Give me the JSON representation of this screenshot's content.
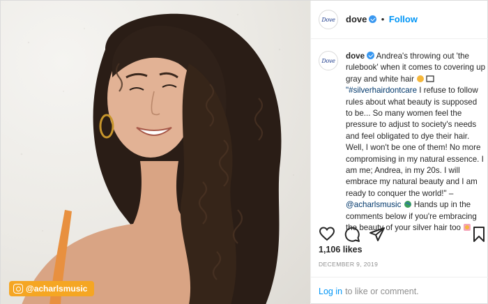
{
  "post": {
    "account": {
      "username": "dove",
      "logo_text": "Dove",
      "verified": true,
      "follow_label": "Follow",
      "separator": "•"
    },
    "photo": {
      "tag_label": "@acharlsmusic",
      "tag_color": "#f5a623"
    },
    "caption": {
      "username": "dove",
      "line1": " Andrea's throwing out 'the rulebook' when it comes to covering up gray and white hair ",
      "hashtag": "\"#silverhairdontcare",
      "body": " I refuse to follow rules about what beauty is supposed to be... So many women feel the pressure to adjust to society's needs and feel obligated to dye their hair. Well, I won't be one of them! No more compromising in my natural essence. I am me; Andrea, in my 20s. I will embrace my natural beauty and I am ready to conquer the world!\" – ",
      "mention": "@acharlsmusic",
      "tail": " Hands up in the comments below if you're embracing the beauty of your silver hair too "
    },
    "icons": [
      "heart-icon",
      "comment-icon",
      "share-icon",
      "bookmark-icon",
      "verified-badge-icon",
      "instagram-icon"
    ],
    "likes": "1,106 likes",
    "date": "DECEMBER 9, 2019",
    "footer": {
      "login_label": "Log in",
      "rest": "to like or comment."
    },
    "colors": {
      "link_blue": "#0095f6",
      "verified_blue": "#3897f0",
      "text": "#262626",
      "muted": "#8e8e8e"
    }
  }
}
